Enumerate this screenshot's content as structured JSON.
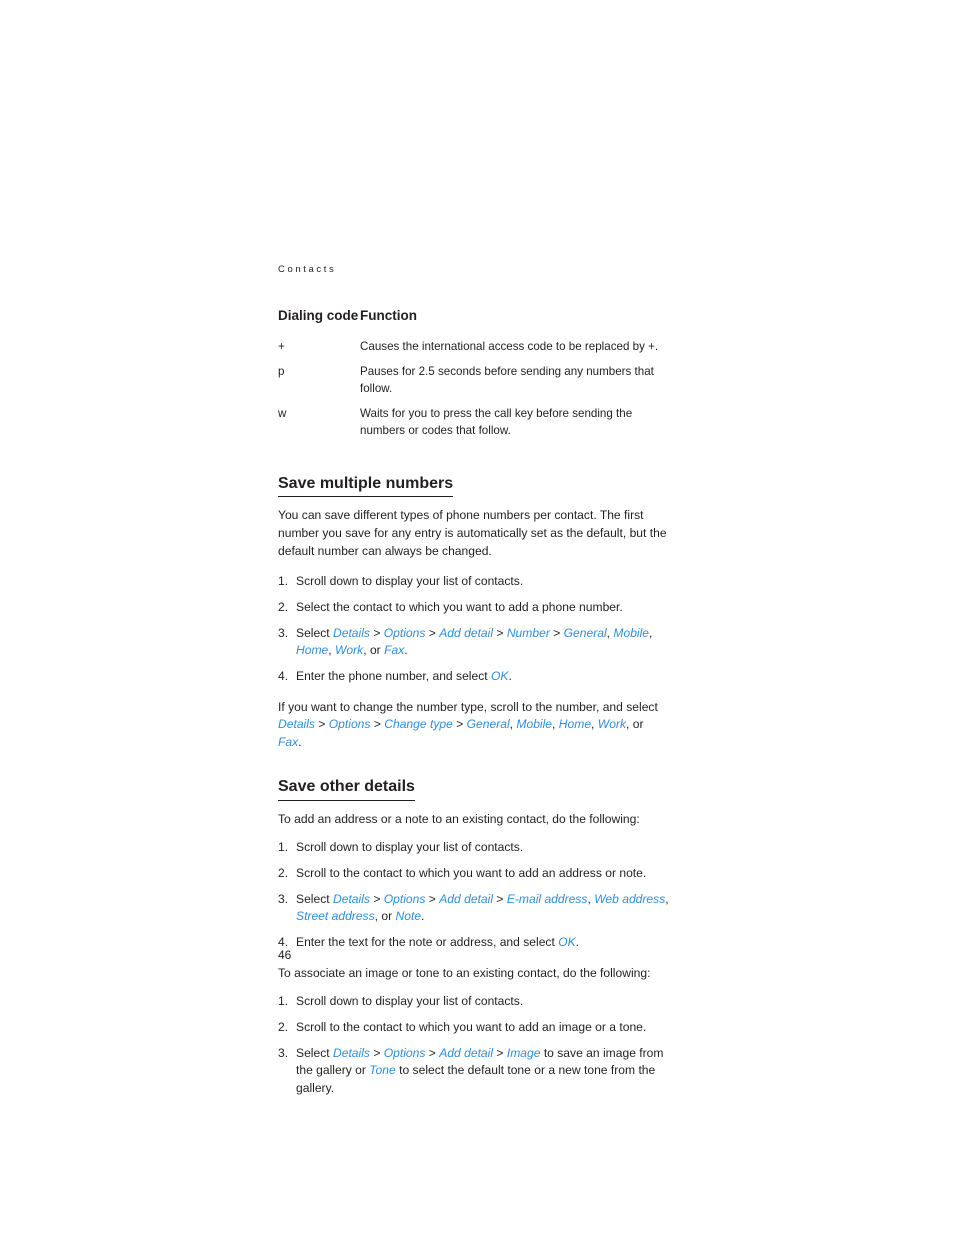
{
  "running_header": "Contacts",
  "page_number": "46",
  "colors": {
    "ui_term": "#2f8ede",
    "text": "#231f20",
    "background": "#ffffff"
  },
  "table": {
    "headers": {
      "code": "Dialing code",
      "function": "Function"
    },
    "rows": [
      {
        "code": "+",
        "function": "Causes the international access code to be replaced by +."
      },
      {
        "code": "p",
        "function": "Pauses for 2.5 seconds before sending any numbers that follow."
      },
      {
        "code": "w",
        "function": "Waits for you to press the call key before sending the numbers or codes that follow."
      }
    ]
  },
  "sections": [
    {
      "heading": "Save multiple numbers",
      "intro": "You can save different types of phone numbers per contact. The first number you save for any entry is automatically set as the default, but the default number can always be changed.",
      "steps": [
        {
          "num": "1.",
          "text": "Scroll down to display your list of contacts."
        },
        {
          "num": "2.",
          "text": "Select the contact to which you want to add a phone number."
        },
        {
          "num": "3.",
          "text": "Select Details > Options > Add detail > Number > General, Mobile, Home, Work, or Fax."
        },
        {
          "num": "4.",
          "text": "Enter the phone number, and select OK."
        }
      ],
      "outro": "If you want to change the number type, scroll to the number, and select Details > Options > Change type > General, Mobile, Home, Work, or Fax."
    },
    {
      "heading": "Save other details",
      "intro": "To add an address or a note to an existing contact, do the following:",
      "steps": [
        {
          "num": "1.",
          "text": "Scroll down to display your list of contacts."
        },
        {
          "num": "2.",
          "text": "Scroll to the contact to which you want to add an address or note."
        },
        {
          "num": "3.",
          "text": "Select Details > Options > Add detail > E-mail address, Web address, Street address, or Note."
        },
        {
          "num": "4.",
          "text": "Enter the text for the note or address, and select OK."
        }
      ],
      "intro2": "To associate an image or tone to an existing contact, do the following:",
      "steps2": [
        {
          "num": "1.",
          "text": "Scroll down to display your list of contacts."
        },
        {
          "num": "2.",
          "text": "Scroll to the contact to which you want to add an image or a tone."
        },
        {
          "num": "3.",
          "text": "Select Details > Options > Add detail > Image to save an image from the gallery or Tone to select the default tone or a new tone from the gallery."
        }
      ]
    }
  ],
  "ui_terms": [
    "Details",
    "Options",
    "Add detail",
    "Number",
    "General",
    "Mobile",
    "Home",
    "Work",
    "Fax",
    "OK",
    "Change type",
    "E-mail address",
    "Web address",
    "Street address",
    "Note",
    "Image",
    "Tone"
  ]
}
